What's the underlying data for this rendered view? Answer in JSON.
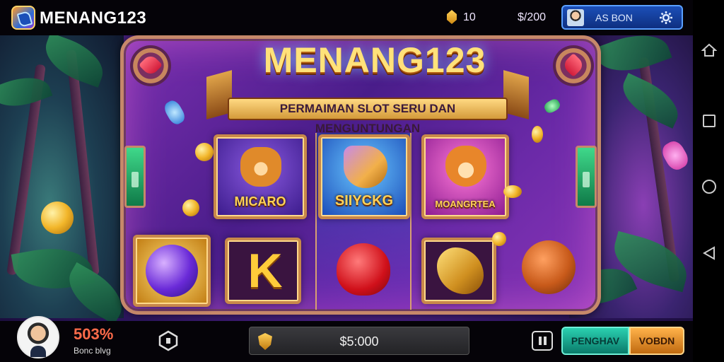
{
  "header": {
    "brand": "MENANG123",
    "coins": "10",
    "balance": "$/200",
    "profile_name": "AS BON"
  },
  "game": {
    "title": "MENANG123",
    "subtitle": "PERMAIMAN SLOT SERU DAN MENGUNTUNGAN",
    "tiles": {
      "cat": "MICARO",
      "shell": "SIIYCKG",
      "fox": "MOANGRTEA"
    }
  },
  "footer": {
    "win_percent": "503%",
    "win_caption": "Bonc blvg",
    "bet_amount": "$5:000",
    "button_left": "PENGHAV",
    "button_right": "VOBDN"
  },
  "colors": {
    "accent_gold": "#ffd257",
    "frame_border": "#c6886a",
    "profile_blue": "#1c4fb8",
    "win_red": "#ff6b4a"
  },
  "icons": [
    "logo-icon",
    "coin-icon",
    "gear-icon",
    "hexagon-icon",
    "shield-icon",
    "pause-icon",
    "home-icon",
    "recents-icon",
    "circle-home-icon",
    "back-icon"
  ]
}
